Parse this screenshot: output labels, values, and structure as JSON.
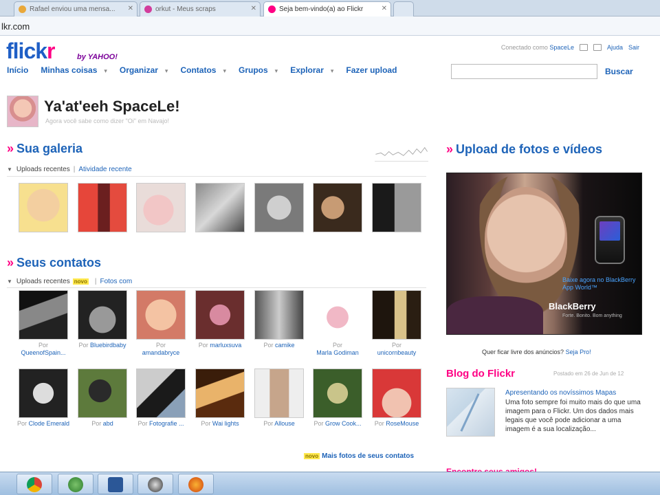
{
  "browser": {
    "tabs": [
      {
        "label": "Rafael enviou uma mensa...",
        "color": "#e9a83a",
        "active": false
      },
      {
        "label": "orkut - Meus scraps",
        "color": "#d23d9c",
        "active": false
      },
      {
        "label": "Seja bem-vindo(a) ao Flickr",
        "color": "#ff0084",
        "active": true
      }
    ],
    "url": "lkr.com"
  },
  "header": {
    "logo_main": "flickr",
    "logo_by": "by YAHOO!",
    "nav": [
      "Início",
      "Minhas coisas",
      "Organizar",
      "Contatos",
      "Grupos",
      "Explorar",
      "Fazer upload"
    ],
    "signed_in_prefix": "Conectado como",
    "signed_in_user": "SpaceLe",
    "help": "Ajuda",
    "signout": "Sair",
    "search_placeholder": "",
    "search_button": "Buscar"
  },
  "greeting": {
    "title": "Ya'at'eeh SpaceLe!",
    "subtitle": "Agora você sabe como dizer \"Oi\" em Navajo!"
  },
  "gallery": {
    "title": "Sua galeria",
    "tab_active": "Uploads recentes",
    "tab_other": "Atividade recente"
  },
  "contacts": {
    "title": "Seus contatos",
    "tab_active": "Uploads recentes",
    "novo": "novo",
    "tab_other": "Fotos com",
    "by_label": "Por",
    "row1": [
      {
        "user": "QueenofSpain..."
      },
      {
        "user": "Bluebirdbaby"
      },
      {
        "user": "amandabryce"
      },
      {
        "user": "marluxsuva"
      },
      {
        "user": "camike"
      },
      {
        "user": "Marla Godiman"
      },
      {
        "user": "unicornbeauty"
      }
    ],
    "row2": [
      {
        "user": "Clode Emerald"
      },
      {
        "user": "abd"
      },
      {
        "user": "Fotografie ..."
      },
      {
        "user": "Wai lights"
      },
      {
        "user": "Allouse"
      },
      {
        "user": "Grow Cook..."
      },
      {
        "user": "RoseMouse"
      }
    ],
    "more_novo": "novo",
    "more_link": "Mais fotos de seus contatos"
  },
  "upload": {
    "title": "Upload de fotos e vídeos",
    "ad_text": "Baixe agora no BlackBerry App World™",
    "ad_brand": "BlackBerry",
    "ad_tagline": "Forte. Bonito. Bom anything",
    "adfree_text": "Quer ficar livre dos anúncios?",
    "adfree_link": "Seja Pro!"
  },
  "blog": {
    "title": "Blog do Flickr",
    "date": "Postado em 26 de Jun de 12",
    "post_title": "Apresentando os novíssimos Mapas",
    "post_body": "Uma foto sempre foi muito mais do que uma imagem para o Flickr. Um dos dados mais legais que você pode adicionar a uma imagem é a sua localização..."
  },
  "cutoff_heading": "Encontre seus amigos!",
  "taskbar": [
    "chrome-icon",
    "network-icon",
    "word-icon",
    "media-icon",
    "firefox-icon"
  ]
}
